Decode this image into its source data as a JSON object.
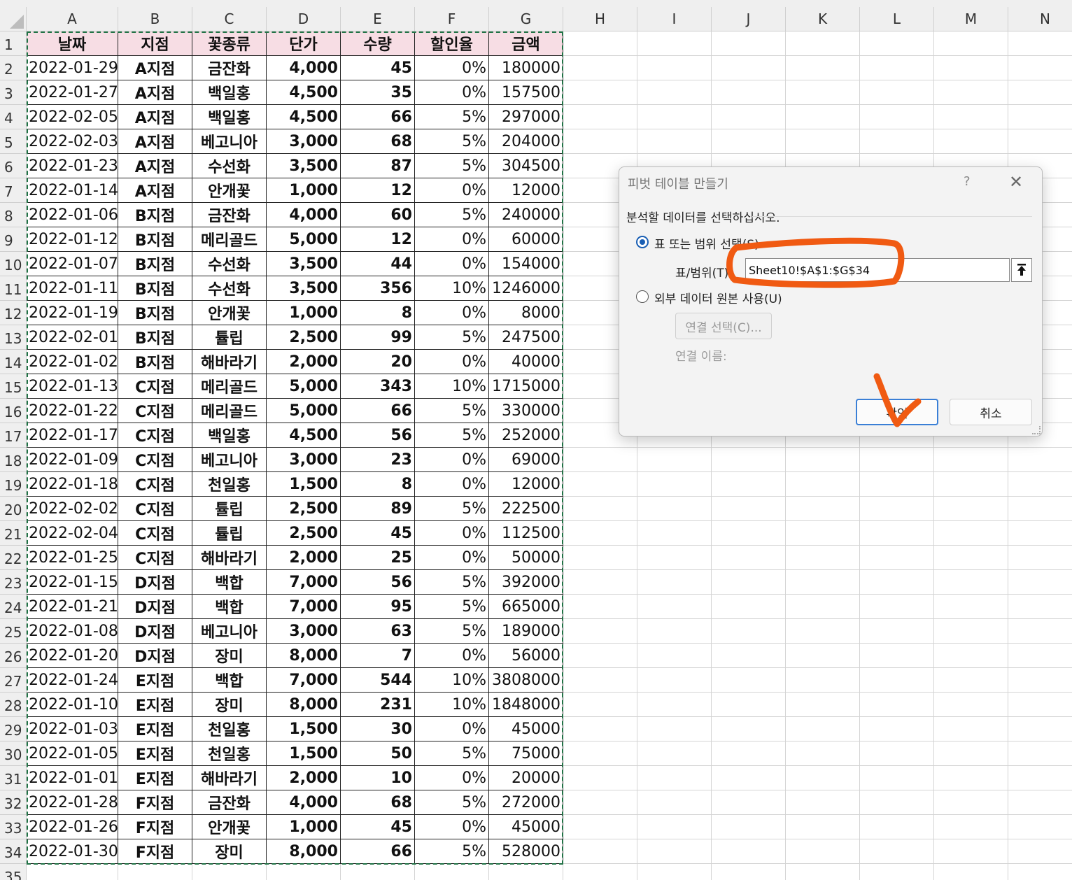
{
  "columns": [
    "A",
    "B",
    "C",
    "D",
    "E",
    "F",
    "G",
    "H",
    "I",
    "J",
    "K",
    "L",
    "M",
    "N"
  ],
  "header_row": [
    "날짜",
    "지점",
    "꽃종류",
    "단가",
    "수량",
    "할인율",
    "금액"
  ],
  "rows": [
    [
      "2022-01-29",
      "A지점",
      "금잔화",
      "4,000",
      "45",
      "0%",
      "180000"
    ],
    [
      "2022-01-27",
      "A지점",
      "백일홍",
      "4,500",
      "35",
      "0%",
      "157500"
    ],
    [
      "2022-02-05",
      "A지점",
      "백일홍",
      "4,500",
      "66",
      "5%",
      "297000"
    ],
    [
      "2022-02-03",
      "A지점",
      "베고니아",
      "3,000",
      "68",
      "5%",
      "204000"
    ],
    [
      "2022-01-23",
      "A지점",
      "수선화",
      "3,500",
      "87",
      "5%",
      "304500"
    ],
    [
      "2022-01-14",
      "A지점",
      "안개꽃",
      "1,000",
      "12",
      "0%",
      "12000"
    ],
    [
      "2022-01-06",
      "B지점",
      "금잔화",
      "4,000",
      "60",
      "5%",
      "240000"
    ],
    [
      "2022-01-12",
      "B지점",
      "메리골드",
      "5,000",
      "12",
      "0%",
      "60000"
    ],
    [
      "2022-01-07",
      "B지점",
      "수선화",
      "3,500",
      "44",
      "0%",
      "154000"
    ],
    [
      "2022-01-11",
      "B지점",
      "수선화",
      "3,500",
      "356",
      "10%",
      "1246000"
    ],
    [
      "2022-01-19",
      "B지점",
      "안개꽃",
      "1,000",
      "8",
      "0%",
      "8000"
    ],
    [
      "2022-02-01",
      "B지점",
      "튤립",
      "2,500",
      "99",
      "5%",
      "247500"
    ],
    [
      "2022-01-02",
      "B지점",
      "해바라기",
      "2,000",
      "20",
      "0%",
      "40000"
    ],
    [
      "2022-01-13",
      "C지점",
      "메리골드",
      "5,000",
      "343",
      "10%",
      "1715000"
    ],
    [
      "2022-01-22",
      "C지점",
      "메리골드",
      "5,000",
      "66",
      "5%",
      "330000"
    ],
    [
      "2022-01-17",
      "C지점",
      "백일홍",
      "4,500",
      "56",
      "5%",
      "252000"
    ],
    [
      "2022-01-09",
      "C지점",
      "베고니아",
      "3,000",
      "23",
      "0%",
      "69000"
    ],
    [
      "2022-01-18",
      "C지점",
      "천일홍",
      "1,500",
      "8",
      "0%",
      "12000"
    ],
    [
      "2022-02-02",
      "C지점",
      "튤립",
      "2,500",
      "89",
      "5%",
      "222500"
    ],
    [
      "2022-02-04",
      "C지점",
      "튤립",
      "2,500",
      "45",
      "0%",
      "112500"
    ],
    [
      "2022-01-25",
      "C지점",
      "해바라기",
      "2,000",
      "25",
      "0%",
      "50000"
    ],
    [
      "2022-01-15",
      "D지점",
      "백합",
      "7,000",
      "56",
      "5%",
      "392000"
    ],
    [
      "2022-01-21",
      "D지점",
      "백합",
      "7,000",
      "95",
      "5%",
      "665000"
    ],
    [
      "2022-01-08",
      "D지점",
      "베고니아",
      "3,000",
      "63",
      "5%",
      "189000"
    ],
    [
      "2022-01-20",
      "D지점",
      "장미",
      "8,000",
      "7",
      "0%",
      "56000"
    ],
    [
      "2022-01-24",
      "E지점",
      "백합",
      "7,000",
      "544",
      "10%",
      "3808000"
    ],
    [
      "2022-01-10",
      "E지점",
      "장미",
      "8,000",
      "231",
      "10%",
      "1848000"
    ],
    [
      "2022-01-03",
      "E지점",
      "천일홍",
      "1,500",
      "30",
      "0%",
      "45000"
    ],
    [
      "2022-01-05",
      "E지점",
      "천일홍",
      "1,500",
      "50",
      "5%",
      "75000"
    ],
    [
      "2022-01-01",
      "E지점",
      "해바라기",
      "2,000",
      "10",
      "0%",
      "20000"
    ],
    [
      "2022-01-28",
      "F지점",
      "금잔화",
      "4,000",
      "68",
      "5%",
      "272000"
    ],
    [
      "2022-01-26",
      "F지점",
      "안개꽃",
      "1,000",
      "45",
      "0%",
      "45000"
    ],
    [
      "2022-01-30",
      "F지점",
      "장미",
      "8,000",
      "66",
      "5%",
      "528000"
    ]
  ],
  "extra_row_number": "35",
  "dialog": {
    "title": "피벗 테이블 만들기",
    "help": "?",
    "close": "✕",
    "prompt": "분석할 데이터를 선택하십시오.",
    "option_range": "표 또는 범위 선택(S)",
    "range_label": "표/범위(T):",
    "range_value": "Sheet10!$A$1:$G$34",
    "option_external": "외부 데이터 원본 사용(U)",
    "choose_connection": "연결 선택(C)...",
    "connection_name": "연결 이름:",
    "ok": "확인",
    "cancel": "취소"
  },
  "colors": {
    "header_fill": "#f7dde4",
    "marquee": "#217346",
    "annotation": "#f05a12",
    "radio": "#1a5fb4"
  }
}
